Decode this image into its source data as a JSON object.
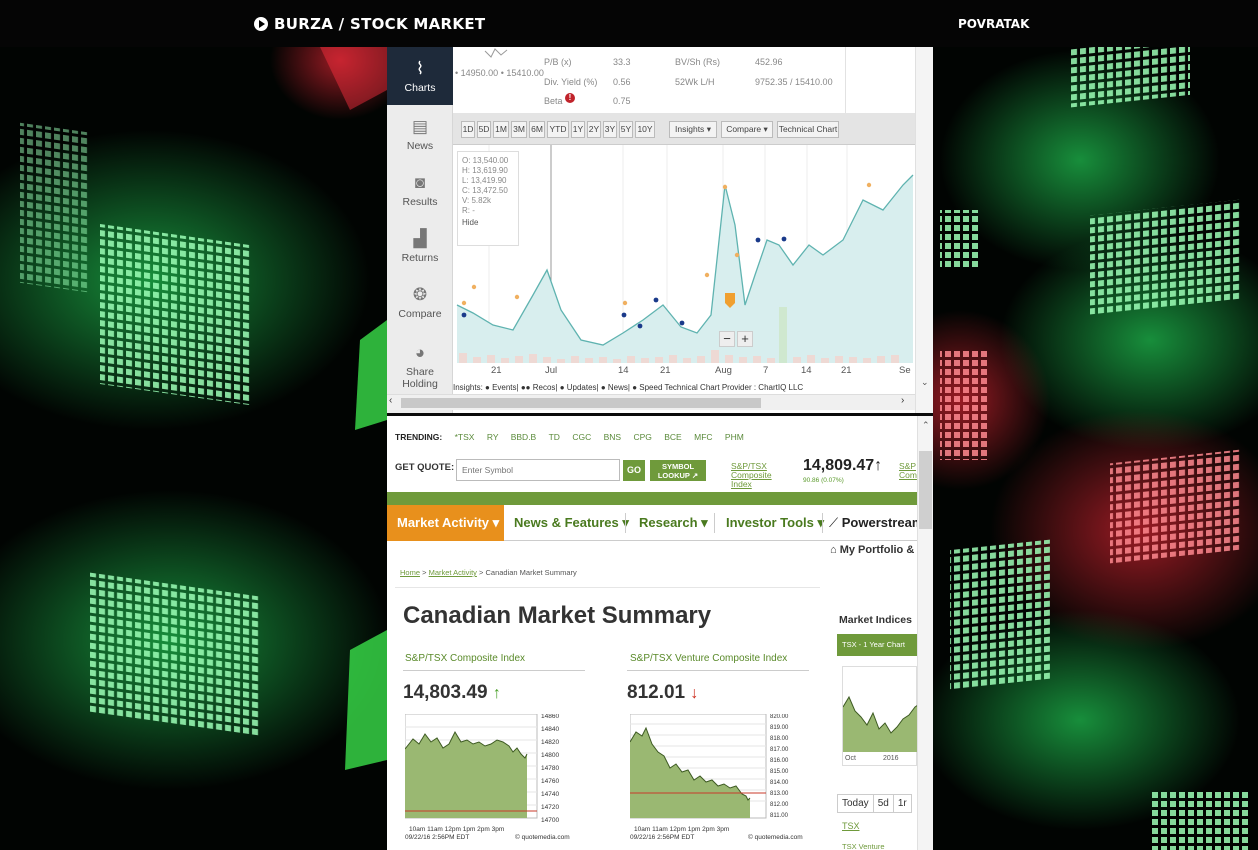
{
  "header": {
    "brand": "BURZA / STOCK MARKET",
    "back": "POVRATAK"
  },
  "chart_panel": {
    "side_nav": [
      {
        "label": "Charts",
        "icon": "line-chart-icon",
        "active": true
      },
      {
        "label": "News",
        "icon": "newspaper-icon"
      },
      {
        "label": "Results",
        "icon": "camera-icon"
      },
      {
        "label": "Returns",
        "icon": "bar-growth-icon"
      },
      {
        "label": "Compare",
        "icon": "circles-icon"
      },
      {
        "label": "Share Holding",
        "icon": "pie-icon"
      }
    ],
    "stats": {
      "range": "• 14950.00 • 15410.00",
      "pb_label": "P/B (x)",
      "pb_value": "33.3",
      "bv_label": "BV/Sh (Rs)",
      "bv_value": "452.96",
      "div_label": "Div. Yield (%)",
      "div_value": "0.56",
      "wk_label": "52Wk L/H",
      "wk_value": "9752.35 / 15410.00",
      "beta_label": "Beta",
      "beta_value": "0.75"
    },
    "toolbar": {
      "periods": [
        "1D",
        "5D",
        "1M",
        "3M",
        "6M",
        "YTD",
        "1Y",
        "2Y",
        "3Y",
        "5Y",
        "10Y"
      ],
      "insights": "Insights",
      "compare": "Compare",
      "technical": "Technical Chart"
    },
    "ohlc": {
      "o": "O: 13,540.00",
      "h": "H: 13,619.90",
      "l": "L: 13,419.90",
      "c": "C: 13,472.50",
      "v": "V: 5.82k",
      "r": "R: -",
      "hide": "Hide"
    },
    "x_labels": [
      "21",
      "Jul",
      "14",
      "21",
      "Aug",
      "7",
      "14",
      "21",
      "Se"
    ],
    "zoom": {
      "minus": "−",
      "plus": "+"
    },
    "insights_legend": "Insights:  ● Events| ●● Recos| ● Updates| ● News| ● Speed    Technical Chart Provider : ChartIQ LLC",
    "colors": {
      "line": "#5fb3b0",
      "fill": "#d8eeee",
      "event": "#f0b060",
      "update": "#1a3a8a"
    }
  },
  "market_page": {
    "trending_label": "TRENDING:",
    "trending": [
      "*TSX",
      "RY",
      "BBD.B",
      "TD",
      "CGC",
      "BNS",
      "CPG",
      "BCE",
      "MFC",
      "PHM"
    ],
    "get_quote": "GET QUOTE:",
    "symbol_placeholder": "Enter Symbol",
    "go": "GO",
    "symbol_lookup": "SYMBOL LOOKUP",
    "index_link": "S&P/TSX Composite Index",
    "index_value": "14,809.47↑",
    "index_change": "90.86 (0.07%)",
    "index_link2": "S&P Com",
    "nav": [
      "Market Activity ▾",
      "News & Features ▾",
      "Research ▾",
      "Investor Tools ▾",
      "Powerstream"
    ],
    "portfolio": "My Portfolio &",
    "breadcrumb": {
      "home": "Home",
      "section": "Market Activity",
      "page": "Canadian Market Summary"
    },
    "title": "Canadian Market Summary",
    "indices": [
      {
        "name": "S&P/TSX Composite Index",
        "value": "14,803.49",
        "dir": "up",
        "yticks": [
          "14860",
          "14840",
          "14820",
          "14800",
          "14780",
          "14760",
          "14740",
          "14720",
          "14700"
        ],
        "xticks": "10am  11am  12pm  1pm  2pm  3pm",
        "date": "09/22/16 2:56PM EDT",
        "credit": "© quotemedia.com"
      },
      {
        "name": "S&P/TSX Venture Composite Index",
        "value": "812.01",
        "dir": "down",
        "yticks": [
          "820.00",
          "819.00",
          "818.00",
          "817.00",
          "816.00",
          "815.00",
          "814.00",
          "813.00",
          "812.00",
          "811.00"
        ],
        "xticks": "10am  11am  12pm  1pm  2pm  3pm",
        "date": "09/22/16 2:56PM EDT",
        "credit": "© quotemedia.com"
      }
    ],
    "sidebar": {
      "heading": "Market Indices",
      "tab": "TSX - 1 Year Chart",
      "chart_x": [
        "Oct",
        "2016"
      ],
      "periods": [
        "Today",
        "5d",
        "1r"
      ],
      "link1": "TSX",
      "link2": "TSX Venture"
    }
  }
}
